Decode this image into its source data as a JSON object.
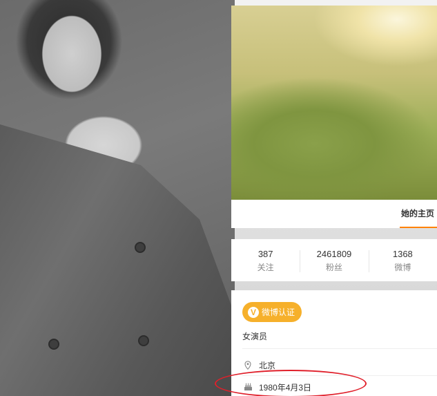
{
  "cover": {
    "tab_label": "她的主页"
  },
  "stats": [
    {
      "value": "387",
      "label": "关注"
    },
    {
      "value": "2461809",
      "label": "粉丝"
    },
    {
      "value": "1368",
      "label": "微博"
    }
  ],
  "badge": {
    "icon_glyph": "V",
    "label": "微博认证",
    "color": "#f6b02b"
  },
  "profile": {
    "occupation": "女演员",
    "location": "北京",
    "birthday": "1980年4月3日"
  },
  "icons": {
    "location": "location-pin-icon",
    "birthday": "birthday-cake-icon"
  },
  "highlight_color": "#e0202b",
  "accent_color": "#ff8200"
}
